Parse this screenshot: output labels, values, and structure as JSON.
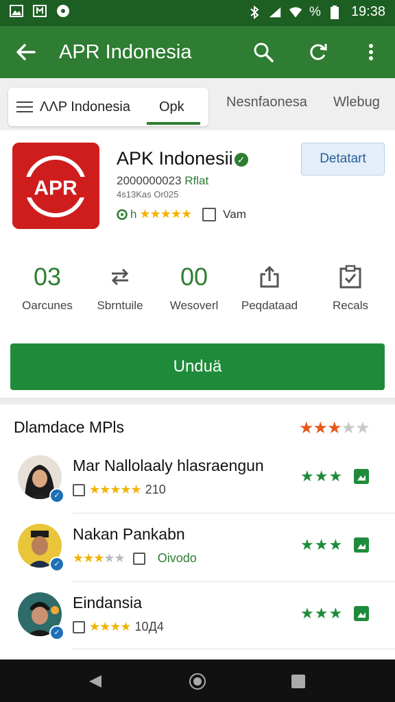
{
  "status": {
    "time": "19:38",
    "battery_text": "%",
    "icons": [
      "image-icon",
      "nfc-icon",
      "circle-icon",
      "bluetooth-icon",
      "signal-icon",
      "wifi-icon",
      "battery-icon"
    ]
  },
  "appbar": {
    "title": "APR Indonesia",
    "icons": [
      "back-arrow-icon",
      "search-icon",
      "refresh-icon",
      "more-vert-icon"
    ]
  },
  "tabs": [
    "ΛΛP Indonesia",
    "Opk",
    "Nesnfaonesa",
    "Wlebug"
  ],
  "app": {
    "icon_text": "APR",
    "name": "APK Indonesii",
    "version": "2000000023",
    "tag": "Rflat",
    "sub": "4s13Kas Or025",
    "rating_prefix": "h",
    "stars": 5,
    "rating_label": "Vam",
    "detail_button": "Detatart",
    "brand_red": "#cf1d1d",
    "accent_green": "#2e7d32"
  },
  "stats": [
    {
      "value": "03",
      "label": "Oarcunes",
      "icon": ""
    },
    {
      "value": "",
      "label": "Sbrntuile",
      "icon": "swap-icon"
    },
    {
      "value": "00",
      "label": "Wesoverl",
      "icon": ""
    },
    {
      "value": "",
      "label": "Peqdataad",
      "icon": "share-icon"
    },
    {
      "value": "",
      "label": "Recals",
      "icon": "clipboard-check-icon"
    }
  ],
  "install_button": "Unduä",
  "reviews": {
    "title": "Dlamdace MPls",
    "rating": 3,
    "items": [
      {
        "name": "Mar Nallolaaly hlasraengun",
        "stars": 5,
        "meta": "210",
        "right_stars": 3
      },
      {
        "name": "Nakan Pankabn",
        "stars": 3,
        "meta": "Oivodo",
        "right_stars": 3
      },
      {
        "name": "Eindansia",
        "stars": 4,
        "meta": "10Д4",
        "right_stars": 3
      }
    ]
  },
  "nav": {
    "icons": [
      "nav-back-icon",
      "nav-home-icon",
      "nav-recents-icon"
    ]
  }
}
